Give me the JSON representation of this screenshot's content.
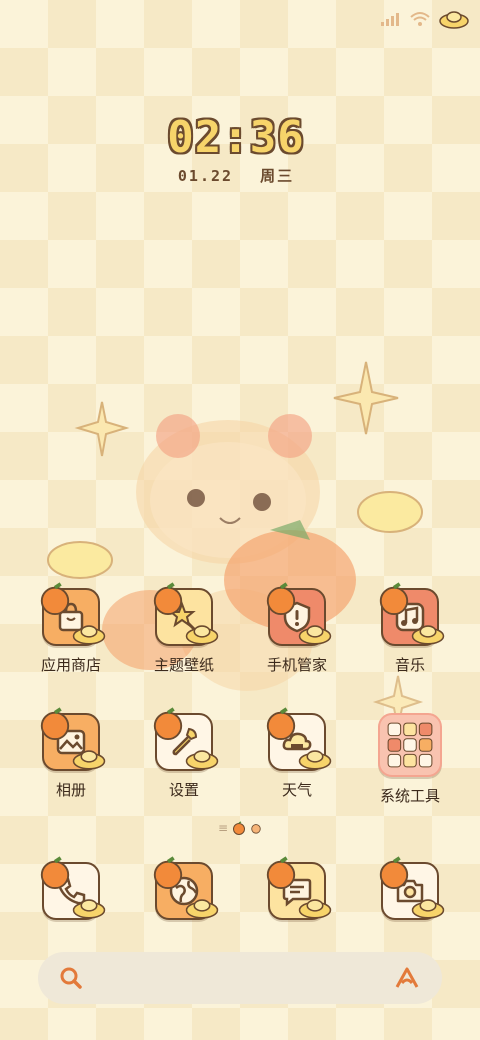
{
  "status": {
    "signal_icon": "signal-icon",
    "wifi_icon": "wifi-icon",
    "battery_icon": "battery-icon"
  },
  "clock": {
    "time": "02:36",
    "date": "01.22",
    "weekday": "周三"
  },
  "apps": [
    {
      "label": "应用商店",
      "icon": "shopping-bag-icon",
      "bg": "#f7ae63"
    },
    {
      "label": "主题壁纸",
      "icon": "star-brush-icon",
      "bg": "#fde3a0"
    },
    {
      "label": "手机管家",
      "icon": "shield-icon",
      "bg": "#ef8a6a"
    },
    {
      "label": "音乐",
      "icon": "music-note-icon",
      "bg": "#ef8a6a"
    },
    {
      "label": "相册",
      "icon": "gallery-icon",
      "bg": "#f7ae63"
    },
    {
      "label": "设置",
      "icon": "wrench-icon",
      "bg": "#fff6e6"
    },
    {
      "label": "天气",
      "icon": "weather-icon",
      "bg": "#fff6e6"
    },
    {
      "label": "系统工具",
      "icon": "folder-grid-icon",
      "bg": "#f9c3b0"
    }
  ],
  "dock": [
    {
      "icon": "phone-icon",
      "bg": "#fff6e6"
    },
    {
      "icon": "browser-icon",
      "bg": "#f7ae63"
    },
    {
      "icon": "message-icon",
      "bg": "#fde3a0"
    },
    {
      "icon": "camera-icon",
      "bg": "#fff6e6"
    }
  ],
  "search": {
    "left_icon": "search-icon",
    "right_icon": "assistant-icon"
  }
}
